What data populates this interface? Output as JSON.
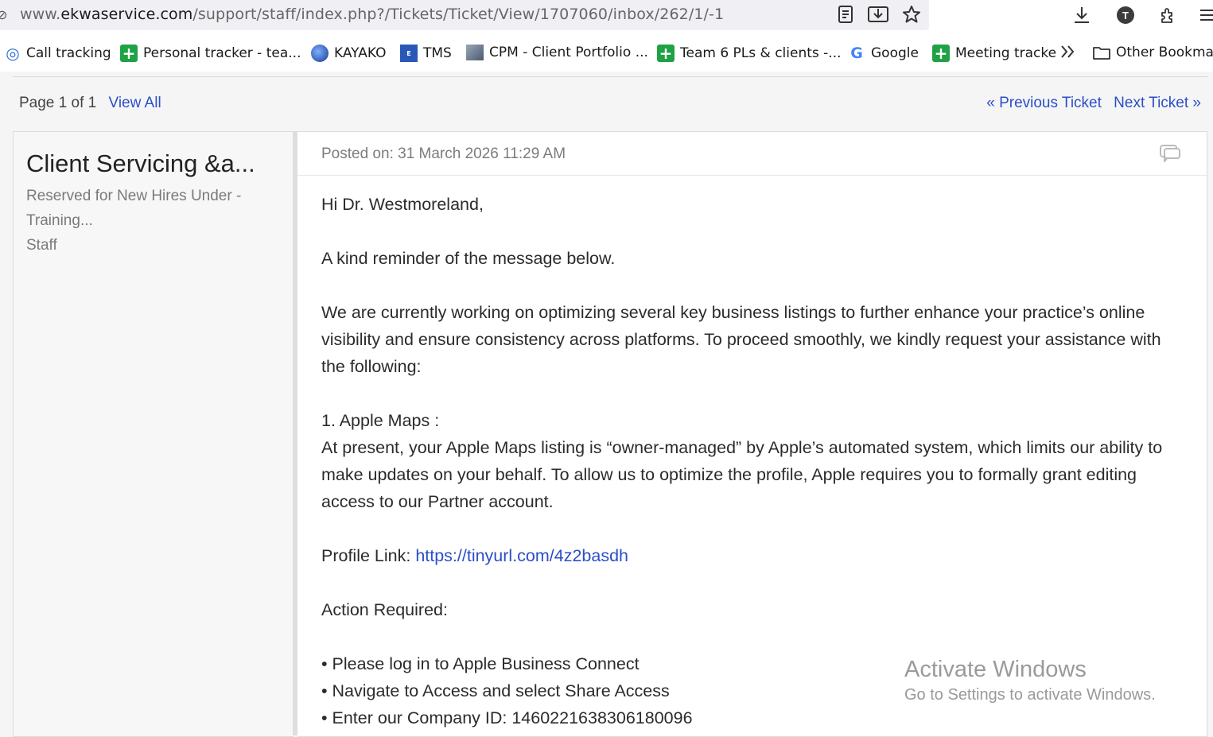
{
  "browser": {
    "url_prefix": "www.",
    "url_domain": "ekwaservice.com",
    "url_path": "/support/staff/index.php?/Tickets/Ticket/View/1707060/inbox/262/1/-1",
    "avatar_initial": "T"
  },
  "bookmarks": [
    {
      "label": "Call tracking",
      "icon": "call-tracking-icon"
    },
    {
      "label": "Personal tracker - tea...",
      "icon": "sheets-plus-icon"
    },
    {
      "label": "KAYAKO",
      "icon": "kayako-globe-icon"
    },
    {
      "label": "TMS",
      "icon": "tms-icon"
    },
    {
      "label": "CPM - Client Portfolio ...",
      "icon": "cpm-icon"
    },
    {
      "label": "Team 6 PLs & clients -...",
      "icon": "sheets-plus-icon"
    },
    {
      "label": "Google",
      "icon": "google-icon"
    },
    {
      "label": "Meeting tracke",
      "icon": "sheets-plus-icon"
    }
  ],
  "bookmarks_other": "Other Bookmar",
  "pager": {
    "page_label": "Page 1 of 1",
    "view_all": "View All"
  },
  "ticket_nav": {
    "previous": "« Previous Ticket",
    "next": "Next Ticket »"
  },
  "left_panel": {
    "title": "Client Servicing &a...",
    "subtitle": "Reserved for New Hires Under - Training...",
    "role": "Staff"
  },
  "post": {
    "posted_on": "Posted on: 31 March 2026 11:29 AM",
    "greeting": "Hi Dr. Westmoreland,",
    "reminder": "A kind reminder of the message below.",
    "intro": "We are currently working on optimizing several key business listings to further enhance your practice’s online visibility and ensure consistency across platforms. To proceed smoothly, we kindly request your assistance with the following:",
    "section_title": "1. Apple Maps :",
    "section_body": "At present, your Apple Maps listing is “owner-managed” by Apple’s automated system, which limits our ability to make updates on your behalf. To allow us to optimize the profile, Apple requires you to formally grant editing access to our Partner account.",
    "profile_label": "Profile Link: ",
    "profile_link": "https://tinyurl.com/4z2basdh",
    "action_required": "Action Required:",
    "steps": [
      "• Please log in to Apple Business Connect",
      "• Navigate to Access and select Share Access",
      "• Enter our Company ID: 1460221638306180096"
    ]
  },
  "watermark": {
    "title": "Activate Windows",
    "subtitle": "Go to Settings to activate Windows."
  }
}
